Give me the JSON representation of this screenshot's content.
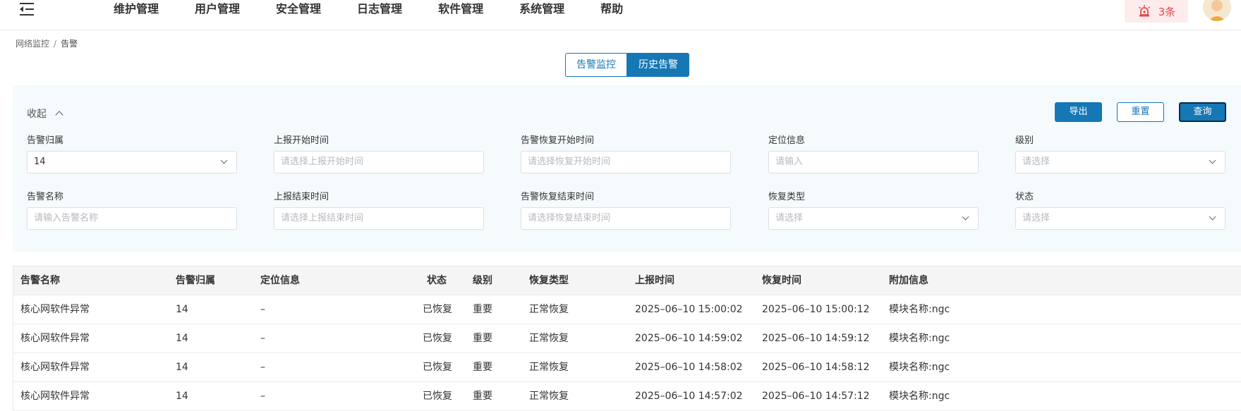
{
  "nav": {
    "items": [
      "维护管理",
      "用户管理",
      "安全管理",
      "日志管理",
      "软件管理",
      "系统管理",
      "帮助"
    ]
  },
  "alarm": {
    "count": "3条",
    "icon": "alarm-light-icon",
    "color": "#e5484d"
  },
  "breadcrumb": {
    "parent": "网络监控",
    "separator": "/",
    "current": "告警"
  },
  "tabs": {
    "monitor": "告警监控",
    "history": "历史告警"
  },
  "filter": {
    "collapse_label": "收起",
    "export_label": "导出",
    "reset_label": "重置",
    "query_label": "查询",
    "fields": {
      "owner": {
        "label": "告警归属",
        "value": "14"
      },
      "report_start": {
        "label": "上报开始时间",
        "placeholder": "请选择上报开始时间"
      },
      "recover_start": {
        "label": "告警恢复开始时间",
        "placeholder": "请选择恢复开始时间"
      },
      "location": {
        "label": "定位信息",
        "placeholder": "请输入"
      },
      "level": {
        "label": "级别",
        "placeholder": "请选择"
      },
      "name": {
        "label": "告警名称",
        "placeholder": "请输入告警名称"
      },
      "report_end": {
        "label": "上报结束时间",
        "placeholder": "请选择上报结束时间"
      },
      "recover_end": {
        "label": "告警恢复结束时间",
        "placeholder": "请选择恢复结束时间"
      },
      "recover_type": {
        "label": "恢复类型",
        "placeholder": "请选择"
      },
      "status": {
        "label": "状态",
        "placeholder": "请选择"
      }
    }
  },
  "table": {
    "columns": [
      "告警名称",
      "告警归属",
      "定位信息",
      "状态",
      "级别",
      "恢复类型",
      "上报时间",
      "恢复时间",
      "附加信息"
    ],
    "rows": [
      [
        "核心网软件异常",
        "14",
        "–",
        "已恢复",
        "重要",
        "正常恢复",
        "2025–06–10 15:00:02",
        "2025–06–10 15:00:12",
        "模块名称:ngc"
      ],
      [
        "核心网软件异常",
        "14",
        "–",
        "已恢复",
        "重要",
        "正常恢复",
        "2025–06–10 14:59:02",
        "2025–06–10 14:59:12",
        "模块名称:ngc"
      ],
      [
        "核心网软件异常",
        "14",
        "–",
        "已恢复",
        "重要",
        "正常恢复",
        "2025–06–10 14:58:02",
        "2025–06–10 14:58:12",
        "模块名称:ngc"
      ],
      [
        "核心网软件异常",
        "14",
        "–",
        "已恢复",
        "重要",
        "正常恢复",
        "2025–06–10 14:57:02",
        "2025–06–10 14:57:12",
        "模块名称:ngc"
      ]
    ]
  },
  "colors": {
    "primary": "#1677b5",
    "filter_bg": "#f5fafd",
    "header_bg": "#f5f5f5"
  }
}
